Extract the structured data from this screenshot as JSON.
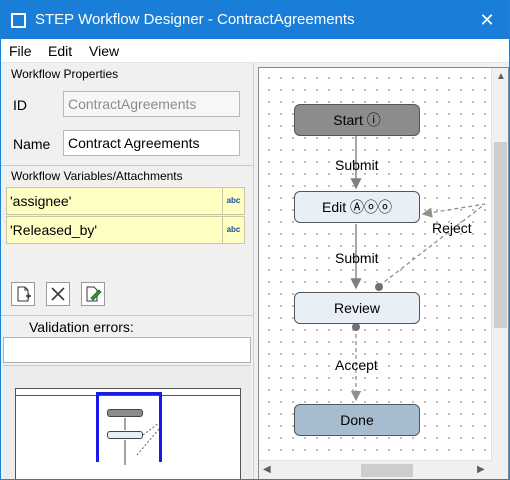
{
  "window": {
    "title": "STEP Workflow Designer - ContractAgreements",
    "close_glyph": "✕"
  },
  "menu": {
    "file": "File",
    "edit": "Edit",
    "view": "View"
  },
  "properties": {
    "section_title": "Workflow Properties",
    "id_label": "ID",
    "id_value": "ContractAgreements",
    "name_label": "Name",
    "name_value": "Contract Agreements"
  },
  "variables": {
    "section_title": "Workflow Variables/Attachments",
    "rows": [
      {
        "text": "'assignee'",
        "badge": "abc"
      },
      {
        "text": "'Released_by'",
        "badge": "abc"
      }
    ]
  },
  "toolbar": {
    "new_icon": "new-document-icon",
    "delete_icon": "delete-x-icon",
    "edit_icon": "edit-pencil-icon"
  },
  "validation": {
    "label": "Validation errors:"
  },
  "diagram": {
    "nodes": {
      "start": "Start ⓘ",
      "edit": "Edit Ⓐⓞⓞ",
      "review": "Review",
      "done": "Done"
    },
    "edges": {
      "start_edit": "Submit",
      "edit_review": "Submit",
      "review_edit": "Reject",
      "review_done": "Accept"
    }
  },
  "colors": {
    "titlebar": "#1a7ed8",
    "start_node": "#8c8c8c",
    "task_node": "#e9eff6",
    "done_node": "#a8bccf",
    "variable_row": "#ffffc4",
    "preview_viewport": "#1a1ae6"
  }
}
